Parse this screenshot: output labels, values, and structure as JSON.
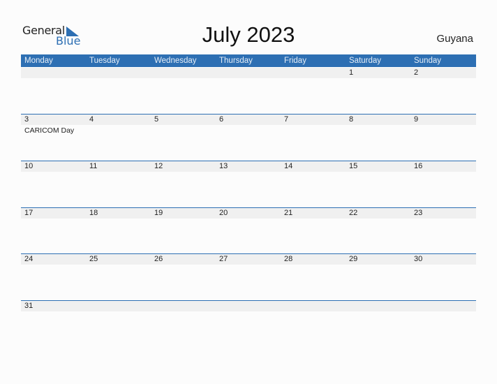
{
  "logo": {
    "word1": "General",
    "word2": "Blue"
  },
  "title": "July 2023",
  "country": "Guyana",
  "colors": {
    "accent": "#2d6fb3",
    "day_bar": "#f0f0f0"
  },
  "weekdays": [
    "Monday",
    "Tuesday",
    "Wednesday",
    "Thursday",
    "Friday",
    "Saturday",
    "Sunday"
  ],
  "weeks": [
    {
      "days": [
        "",
        "",
        "",
        "",
        "",
        "1",
        "2"
      ],
      "events": [
        "",
        "",
        "",
        "",
        "",
        "",
        ""
      ]
    },
    {
      "days": [
        "3",
        "4",
        "5",
        "6",
        "7",
        "8",
        "9"
      ],
      "events": [
        "CARICOM Day",
        "",
        "",
        "",
        "",
        "",
        ""
      ]
    },
    {
      "days": [
        "10",
        "11",
        "12",
        "13",
        "14",
        "15",
        "16"
      ],
      "events": [
        "",
        "",
        "",
        "",
        "",
        "",
        ""
      ]
    },
    {
      "days": [
        "17",
        "18",
        "19",
        "20",
        "21",
        "22",
        "23"
      ],
      "events": [
        "",
        "",
        "",
        "",
        "",
        "",
        ""
      ]
    },
    {
      "days": [
        "24",
        "25",
        "26",
        "27",
        "28",
        "29",
        "30"
      ],
      "events": [
        "",
        "",
        "",
        "",
        "",
        "",
        ""
      ]
    },
    {
      "days": [
        "31",
        "",
        "",
        "",
        "",
        "",
        ""
      ],
      "events": [
        "",
        "",
        "",
        "",
        "",
        "",
        ""
      ]
    }
  ]
}
